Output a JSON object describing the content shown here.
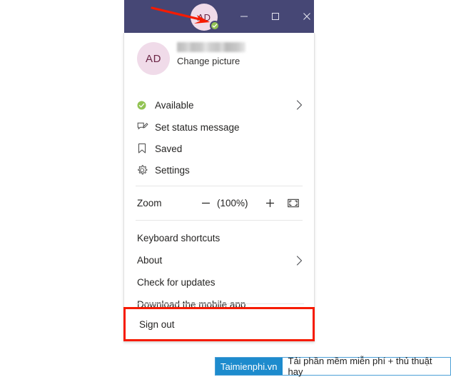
{
  "titlebar": {
    "avatar_initials": "AD",
    "presence_icon": "check-badge-icon",
    "minimize_label": "minimize-icon",
    "maximize_label": "maximize-icon",
    "close_label": "close-icon",
    "bar_color": "#464775",
    "avatar_color": "#f0dbe9",
    "presence_color": "#92c353"
  },
  "annotation": {
    "arrow_color": "#f61b00",
    "highlight_color": "#f61b00"
  },
  "panel": {
    "profile": {
      "avatar_initials": "AD",
      "name": "",
      "change_picture_label": "Change picture"
    },
    "status_items": [
      {
        "label": "Available",
        "icon": "presence-available-icon",
        "chevron": true
      },
      {
        "label": "Set status message",
        "icon": "status-message-icon",
        "chevron": false
      },
      {
        "label": "Saved",
        "icon": "bookmark-icon",
        "chevron": false
      },
      {
        "label": "Settings",
        "icon": "gear-icon",
        "chevron": false
      }
    ],
    "zoom": {
      "label": "Zoom",
      "decrease_icon": "minus-icon",
      "value": "(100%)",
      "increase_icon": "plus-icon",
      "fullscreen_icon": "fullscreen-icon"
    },
    "link_items": [
      {
        "label": "Keyboard shortcuts",
        "chevron": false
      },
      {
        "label": "About",
        "chevron": true
      },
      {
        "label": "Check for updates",
        "chevron": false
      },
      {
        "label": "Download the mobile app",
        "chevron": false
      }
    ],
    "sign_out_label": "Sign out"
  },
  "watermark": {
    "brand": "Taimienphi.vn",
    "text": "Tải phần mềm miễn phí + thủ thuật hay",
    "brand_color": "#1d8bcd"
  }
}
